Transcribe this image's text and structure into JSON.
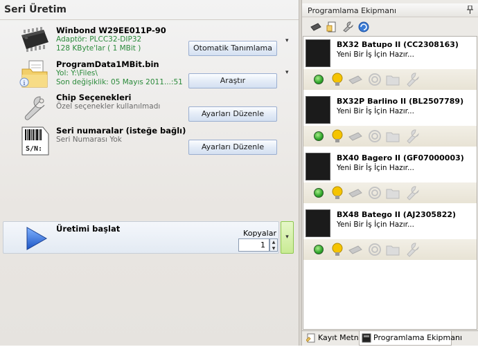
{
  "window": {
    "title": "Seri Üretim"
  },
  "items": [
    {
      "title": "Winbond W29EE011P-90",
      "lines": [
        "Adaptör: PLCC32-DIP32",
        "128 KByte'lar ( 1 MBit )"
      ],
      "button": "Otomatik Tanımlama",
      "dropdown": "▾",
      "icon": "chip-icon"
    },
    {
      "title": "ProgramData1MBit.bin",
      "lines": [
        "Yol: Y:\\Files\\",
        "Son değişiklik: 05 Mayıs 2011...:51"
      ],
      "button": "Araştır",
      "dropdown": "▾",
      "icon": "folder-file-icon"
    },
    {
      "title": "Chip Seçenekleri",
      "lines": [
        "Özel seçenekler kullanılmadı"
      ],
      "button": "Ayarları Düzenle",
      "icon": "wrench-icon"
    },
    {
      "title": "Seri numaralar (isteğe bağlı)",
      "lines": [
        "Seri Numarası Yok"
      ],
      "button": "Ayarları Düzenle",
      "icon": "barcode-sn-icon",
      "icon_text": "S/N:"
    }
  ],
  "start": {
    "label": "Üretimi başlat",
    "copies_label": "Kopyalar",
    "copies_value": "1",
    "dropdown": "▾",
    "spin_up": "▲",
    "spin_down": "▼"
  },
  "panel": {
    "title": "Programlama Ekipmanı",
    "pin": "📌",
    "toolbar_icons": [
      "chip-tool-icon",
      "document-icon",
      "wrench-tool-icon",
      "refresh-icon"
    ],
    "devices": [
      {
        "name": "BX32 Batupo II (CC2308163)",
        "status": "Yeni Bir İş İçin Hazır..."
      },
      {
        "name": "BX32P Barlino II (BL2507789)",
        "status": "Yeni Bir İş İçin Hazır..."
      },
      {
        "name": "BX40 Bagero II (GF07000003)",
        "status": "Yeni Bir İş İçin Hazır..."
      },
      {
        "name": "BX48 Batego II (AJ2305822)",
        "status": "Yeni Bir İş İçin Hazır..."
      }
    ],
    "device_icons": [
      "status-led-icon",
      "lightbulb-icon",
      "chip-status-icon",
      "fingerprint-icon",
      "folder-status-icon",
      "wrench-status-icon"
    ]
  },
  "tabs": [
    {
      "label": "Kayıt Metni",
      "icon": "log-icon"
    },
    {
      "label": "Programlama Ekipmanı",
      "icon": "device-icon"
    }
  ],
  "colors": {
    "green_text": "#2a8a3a",
    "gray_text": "#6a6a6a",
    "led_green": "#2ea52a",
    "bulb_yellow": "#f5c400",
    "start_blue": "#2f6fd6"
  }
}
